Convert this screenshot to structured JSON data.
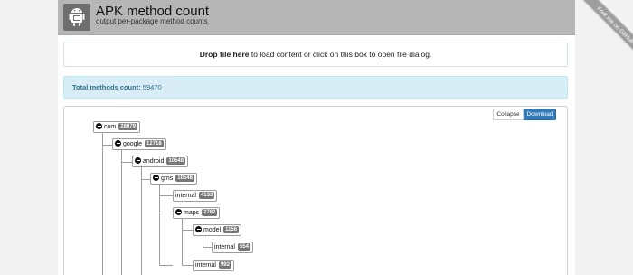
{
  "header": {
    "title": "APK method count",
    "subtitle": "output per-package method counts"
  },
  "ribbon": {
    "label": "Fork me on GitHub"
  },
  "dropzone": {
    "strong": "Drop file here",
    "rest": " to load content or click on this box to open file dialog."
  },
  "summary": {
    "label": "Total methods count:",
    "value": "59470"
  },
  "toolbar": {
    "collapse_label": "Collapse",
    "download_label": "Download"
  },
  "tree": [
    {
      "label": "com",
      "count": "28079",
      "expanded": true
    },
    {
      "label": "google",
      "count": "12718",
      "expanded": true
    },
    {
      "label": "android",
      "count": "10548",
      "expanded": true
    },
    {
      "label": "gms",
      "count": "10548",
      "expanded": true
    },
    {
      "label": "internal",
      "count": "4133",
      "expanded": false
    },
    {
      "label": "maps",
      "count": "2782",
      "expanded": true
    },
    {
      "label": "model",
      "count": "1156",
      "expanded": true
    },
    {
      "label": "internal",
      "count": "554",
      "expanded": false
    },
    {
      "label": "internal",
      "count": "992",
      "expanded": false
    }
  ]
}
